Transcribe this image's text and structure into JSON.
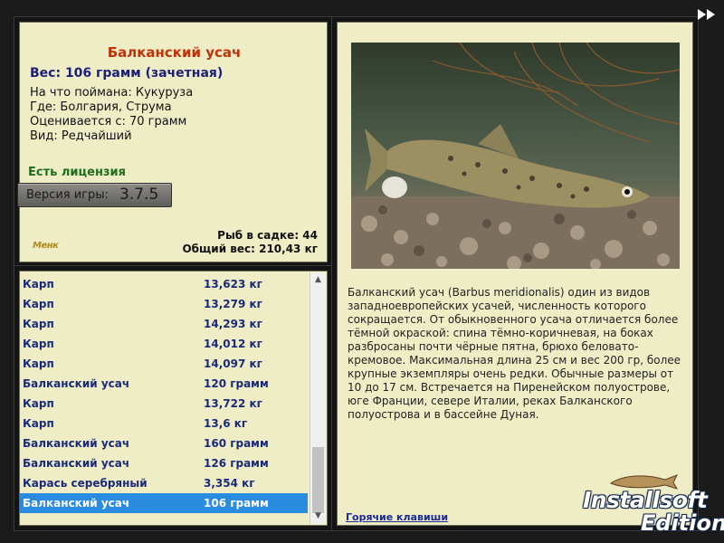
{
  "fish": {
    "title": "Балканский усач",
    "weight_line": "Вес: 106 грамм (зачетная)",
    "caught_on": "На что поймана: Кукуруза",
    "location": "Где: Болгария, Струма",
    "valued_from": "Оценивается с: 70 грамм",
    "rarity": "Вид: Редчайший"
  },
  "license": "Есть лицензия",
  "version": {
    "label": "Версия игры:",
    "value": "3.7.5"
  },
  "cage": {
    "count": "Рыб в садке: 44",
    "total_weight": "Общий вес: 210,43 кг"
  },
  "small_logo": "Менк",
  "catch_list": [
    {
      "name": "Карп",
      "weight": "13,623 кг"
    },
    {
      "name": "Карп",
      "weight": "13,279 кг"
    },
    {
      "name": "Карп",
      "weight": "14,293 кг"
    },
    {
      "name": "Карп",
      "weight": "14,012 кг"
    },
    {
      "name": "Карп",
      "weight": "14,097 кг"
    },
    {
      "name": "Балканский усач",
      "weight": "120 грамм"
    },
    {
      "name": "Карп",
      "weight": "13,722 кг"
    },
    {
      "name": "Карп",
      "weight": "13,6 кг"
    },
    {
      "name": "Балканский усач",
      "weight": "160 грамм"
    },
    {
      "name": "Балканский усач",
      "weight": "126 грамм"
    },
    {
      "name": "Карась серебряный",
      "weight": "3,354 кг"
    },
    {
      "name": "Балканский усач",
      "weight": "106 грамм",
      "selected": true
    }
  ],
  "description": "Балканский усач (Barbus meridionalis) один из видов западноевропейских усачей, численность которого сокращается. От обыкновенного усача отличается более тёмной окраской: спина тёмно-коричневая, на боках разбросаны почти чёрные пятна, брюхо беловато-кремовое. Максимальная длина 25 см и вес 200 гр, более крупные экземпляры очень редки. Обычные размеры от 10 до 17 см. Встречается на Пиренейском полуострове, юге Франции, севере Италии, реках Балканского полуострова и в бассейне Дуная.",
  "hotkeys_link": "Горячие клавиши",
  "brand": {
    "line1": "Installsoft",
    "line2": "Edition"
  },
  "icons": {
    "fast_forward": "fast-forward-icon",
    "scroll_up": "chevron-up-icon",
    "scroll_down": "chevron-down-icon"
  },
  "colors": {
    "panel_bg": "#efedc6",
    "title": "#c0320a",
    "list_text": "#1a2a7a",
    "selection": "#2a8ce0",
    "license": "#1e6e1e"
  }
}
